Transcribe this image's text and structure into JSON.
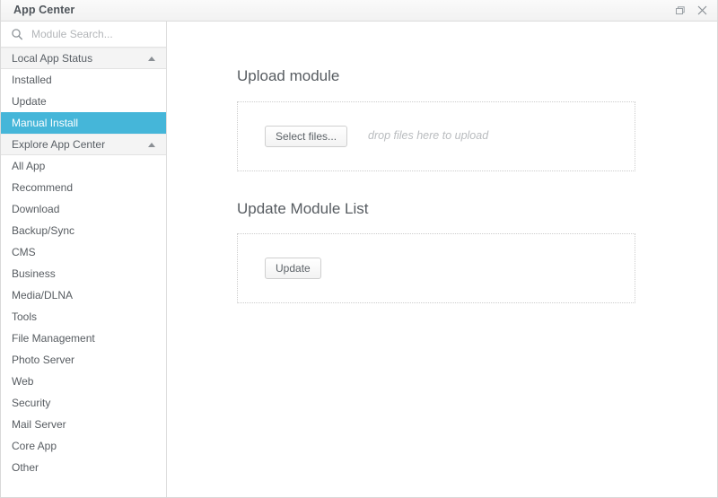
{
  "window": {
    "title": "App Center",
    "controls": [
      {
        "name": "restore-window-button",
        "icon": "restore-icon"
      },
      {
        "name": "close-window-button",
        "icon": "close-icon"
      }
    ]
  },
  "sidebar": {
    "search": {
      "icon": "search-icon",
      "value": "",
      "placeholder": "Module Search..."
    },
    "sections": [
      {
        "name": "local-app-status",
        "label": "Local App Status",
        "expanded": true,
        "caret_icon": "caret-up-icon",
        "items": [
          {
            "name": "sidebar-item-installed",
            "label": "Installed",
            "selected": false
          },
          {
            "name": "sidebar-item-update",
            "label": "Update",
            "selected": false
          },
          {
            "name": "sidebar-item-manual-install",
            "label": "Manual Install",
            "selected": true
          }
        ]
      },
      {
        "name": "explore-app-center",
        "label": "Explore App Center",
        "expanded": true,
        "caret_icon": "caret-up-icon",
        "items": [
          {
            "name": "sidebar-item-all-app",
            "label": "All App",
            "selected": false
          },
          {
            "name": "sidebar-item-recommend",
            "label": "Recommend",
            "selected": false
          },
          {
            "name": "sidebar-item-download",
            "label": "Download",
            "selected": false
          },
          {
            "name": "sidebar-item-backup-sync",
            "label": "Backup/Sync",
            "selected": false
          },
          {
            "name": "sidebar-item-cms",
            "label": "CMS",
            "selected": false
          },
          {
            "name": "sidebar-item-business",
            "label": "Business",
            "selected": false
          },
          {
            "name": "sidebar-item-media-dlna",
            "label": "Media/DLNA",
            "selected": false
          },
          {
            "name": "sidebar-item-tools",
            "label": "Tools",
            "selected": false
          },
          {
            "name": "sidebar-item-file-management",
            "label": "File Management",
            "selected": false
          },
          {
            "name": "sidebar-item-photo-server",
            "label": "Photo Server",
            "selected": false
          },
          {
            "name": "sidebar-item-web",
            "label": "Web",
            "selected": false
          },
          {
            "name": "sidebar-item-security",
            "label": "Security",
            "selected": false
          },
          {
            "name": "sidebar-item-mail-server",
            "label": "Mail Server",
            "selected": false
          },
          {
            "name": "sidebar-item-core-app",
            "label": "Core App",
            "selected": false
          },
          {
            "name": "sidebar-item-other",
            "label": "Other",
            "selected": false
          }
        ]
      }
    ]
  },
  "main": {
    "upload_panel": {
      "title": "Upload module",
      "select_files_label": "Select files...",
      "drop_hint": "drop files here to upload"
    },
    "update_panel": {
      "title": "Update Module List",
      "update_label": "Update"
    }
  },
  "colors": {
    "accent_selected": "#45b6d9",
    "titlebar_text": "#4f555b",
    "body_text": "#575c61",
    "muted_text": "#b9bcbf",
    "border": "#dddddd"
  }
}
